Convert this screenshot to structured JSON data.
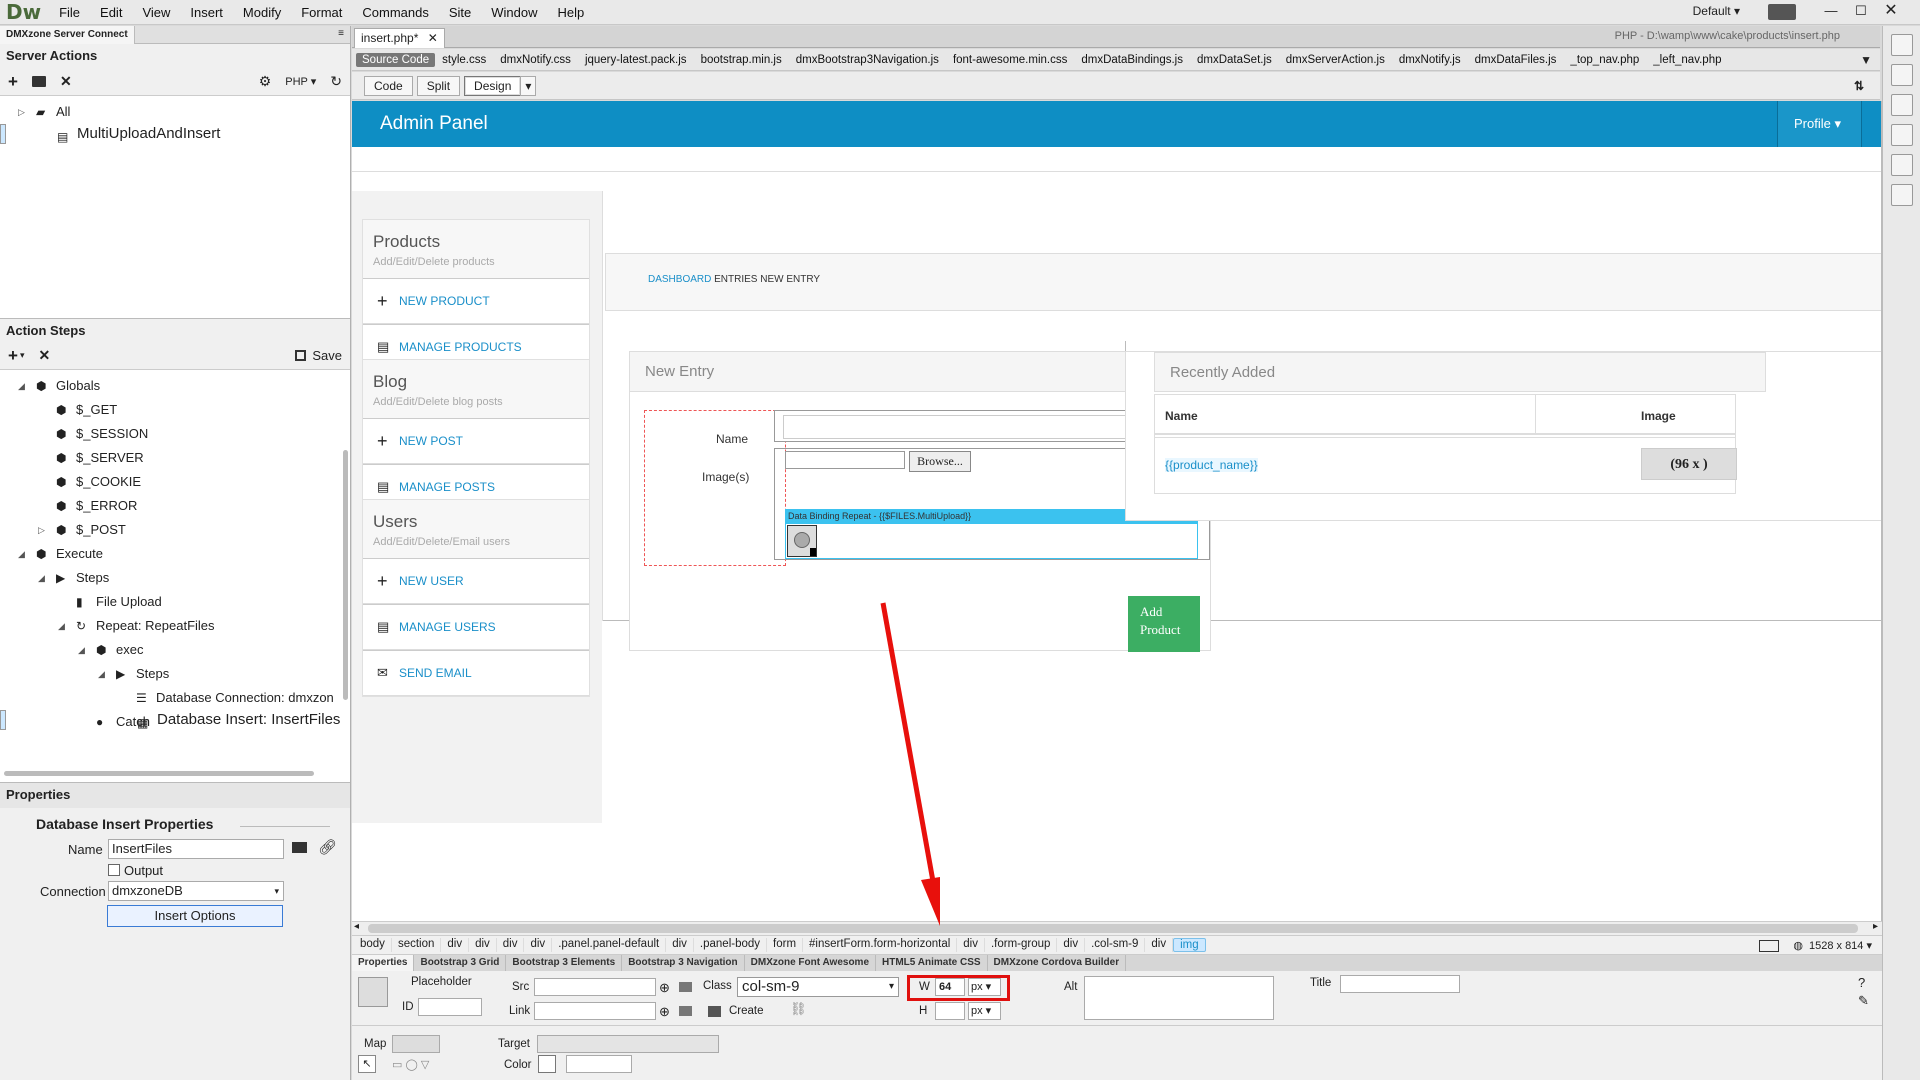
{
  "app": {
    "logo": "Dw",
    "workspace": "Default",
    "menus": [
      "File",
      "Edit",
      "View",
      "Insert",
      "Modify",
      "Format",
      "Commands",
      "Site",
      "Window",
      "Help"
    ]
  },
  "left_panel": {
    "tab": "DMXzone Server Connect",
    "server_actions_title": "Server Actions",
    "php_label": "PHP",
    "tree": [
      {
        "label": "All",
        "depth": 0,
        "arrow": "right",
        "icon": "folder-icon"
      },
      {
        "label": "MultiUploadAndInsert",
        "depth": 1,
        "icon": "file-icon",
        "selected": true
      }
    ],
    "action_steps_title": "Action Steps",
    "save_label": "Save",
    "steps": [
      {
        "label": "Globals",
        "depth": 0,
        "arrow": "down",
        "icon": "cube-icon"
      },
      {
        "label": "$_GET",
        "depth": 1,
        "icon": "cube-icon"
      },
      {
        "label": "$_SESSION",
        "depth": 1,
        "icon": "cube-icon"
      },
      {
        "label": "$_SERVER",
        "depth": 1,
        "icon": "cube-icon"
      },
      {
        "label": "$_COOKIE",
        "depth": 1,
        "icon": "cube-icon"
      },
      {
        "label": "$_ERROR",
        "depth": 1,
        "icon": "cube-icon"
      },
      {
        "label": "$_POST",
        "depth": 1,
        "arrow": "right",
        "icon": "cube-icon"
      },
      {
        "label": "Execute",
        "depth": 0,
        "arrow": "down",
        "icon": "cube-icon"
      },
      {
        "label": "Steps",
        "depth": 1,
        "arrow": "down",
        "icon": "play-icon"
      },
      {
        "label": "File Upload",
        "depth": 2,
        "icon": "upload-icon"
      },
      {
        "label": "Repeat: RepeatFiles",
        "depth": 2,
        "arrow": "down",
        "icon": "repeat-icon"
      },
      {
        "label": "exec",
        "depth": 3,
        "arrow": "down",
        "icon": "cube-icon"
      },
      {
        "label": "Steps",
        "depth": 4,
        "arrow": "down",
        "icon": "play-icon"
      },
      {
        "label": "Database Connection: dmxzon",
        "depth": 5,
        "icon": "database-icon"
      },
      {
        "label": "Database Insert: InsertFiles",
        "depth": 5,
        "icon": "table-icon",
        "selected": true
      },
      {
        "label": "Catch",
        "depth": 3,
        "icon": "exclamation-icon"
      }
    ],
    "properties_title": "Properties",
    "db_insert_title": "Database Insert Properties",
    "name_label": "Name",
    "name_value": "InsertFiles",
    "output_label": "Output",
    "connection_label": "Connection",
    "connection_value": "dmxzoneDB",
    "insert_options_label": "Insert Options"
  },
  "doc": {
    "tab_label": "insert.php*",
    "path": "PHP - D:\\wamp\\www\\cake\\products\\insert.php",
    "related_files": [
      "Source Code",
      "style.css",
      "dmxNotify.css",
      "jquery-latest.pack.js",
      "bootstrap.min.js",
      "dmxBootstrap3Navigation.js",
      "font-awesome.min.css",
      "dmxDataBindings.js",
      "dmxDataSet.js",
      "dmxServerAction.js",
      "dmxNotify.js",
      "dmxDataFiles.js",
      "_top_nav.php",
      "_left_nav.php"
    ],
    "views": [
      "Code",
      "Split",
      "Design"
    ]
  },
  "page": {
    "brand": "Admin Panel",
    "profile": "Profile",
    "sidebar": [
      {
        "title": "Products",
        "sub": "Add/Edit/Delete products",
        "links": [
          {
            "label": "NEW PRODUCT",
            "icon": "plus-icon"
          },
          {
            "label": "MANAGE PRODUCTS",
            "icon": "list-icon"
          }
        ]
      },
      {
        "title": "Blog",
        "sub": "Add/Edit/Delete blog posts",
        "links": [
          {
            "label": "NEW POST",
            "icon": "plus-icon"
          },
          {
            "label": "MANAGE POSTS",
            "icon": "list-icon"
          }
        ]
      },
      {
        "title": "Users",
        "sub": "Add/Edit/Delete/Email users",
        "links": [
          {
            "label": "NEW USER",
            "icon": "plus-icon"
          },
          {
            "label": "MANAGE USERS",
            "icon": "list-icon"
          },
          {
            "label": "SEND EMAIL",
            "icon": "envelope-icon"
          }
        ]
      }
    ],
    "breadcrumb": {
      "first": "DASHBOARD",
      "rest": " ENTRIES NEW ENTRY"
    },
    "new_entry": "New Entry",
    "name_label": "Name",
    "images_label": "Image(s)",
    "browse": "Browse...",
    "repeat_label": "Data Binding Repeat - {{$FILES.MultiUpload}}",
    "add_product": "Add Product",
    "recently_added": "Recently Added",
    "col_name": "Name",
    "col_image": "Image",
    "product_name": "{{product_name}}",
    "image_cell": "(96 x )"
  },
  "tags": [
    "body",
    "section",
    "div",
    "div",
    "div",
    "div",
    ".panel.panel-default",
    "div",
    ".panel-body",
    "form",
    "#insertForm.form-horizontal",
    "div",
    ".form-group",
    "div",
    ".col-sm-9",
    "div",
    "img"
  ],
  "dims": "1528 x 814",
  "prop_tabs": [
    "Properties",
    "Bootstrap 3 Grid",
    "Bootstrap 3 Elements",
    "Bootstrap 3 Navigation",
    "DMXzone Font Awesome",
    "HTML5 Animate CSS",
    "DMXzone Cordova Builder"
  ],
  "props": {
    "placeholder": "Placeholder",
    "id": "ID",
    "src": "Src",
    "link": "Link",
    "class": "Class",
    "class_value": "col-sm-9",
    "create": "Create",
    "w": "W",
    "w_value": "64",
    "h": "H",
    "unit": "px",
    "alt": "Alt",
    "title": "Title",
    "map": "Map",
    "target": "Target",
    "color": "Color"
  }
}
